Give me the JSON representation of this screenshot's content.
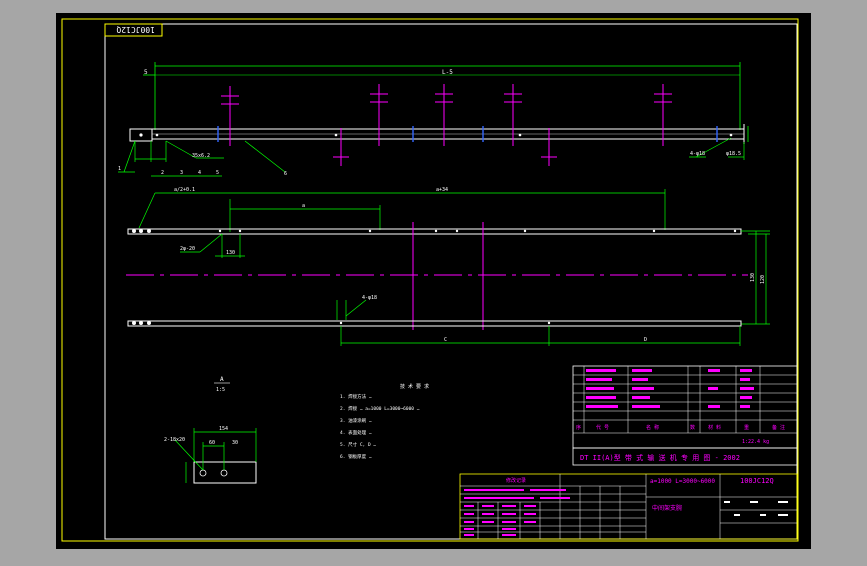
{
  "stamp": {
    "code": "100JC12Q"
  },
  "dimensions": {
    "overall_length": "L-5",
    "left_offset": "5",
    "hole_spacing": "35x6.2",
    "mid_length": "a+34",
    "left_span": "a/2+0.1",
    "inner_length": "a",
    "hole_dim": "2φ-20",
    "pitch": "130",
    "height_a": "130",
    "height_b": "120",
    "seg_c": "C",
    "seg_d": "D",
    "slot_dim": "4-φ18",
    "side_dim": "φ18.5"
  },
  "part_numbers": [
    "1",
    "2",
    "3",
    "4",
    "5",
    "6"
  ],
  "detail": {
    "label": "A",
    "scale": "1:5",
    "dim_top": "154",
    "dim_mid": "60",
    "dim_right": "30",
    "hole": "2-18x20"
  },
  "notes": {
    "title": "技 术 要 求",
    "lines": [
      "1. 焊接方法 …",
      "2. 焊接 … a=1000 L=3000~6000 …",
      "3. 油漆涂刷 …",
      "4. 表面处理 …",
      "5. 尺寸 C, D …",
      "6. 钢板厚度 …"
    ]
  },
  "title_block": {
    "bom_header": [
      "序",
      "代 号",
      "名 称",
      "数",
      "材 料",
      "重",
      "备 注"
    ],
    "series_title": "DT II(A)型 带 式 输 送 机 专 用 图 - 2002",
    "spec": "a=1000 L=3000~6000",
    "drawing_no": "100JC12Q",
    "part_name": "中间架支腕",
    "weight": "1:22.4 kg",
    "rev_header": "修改记录"
  }
}
